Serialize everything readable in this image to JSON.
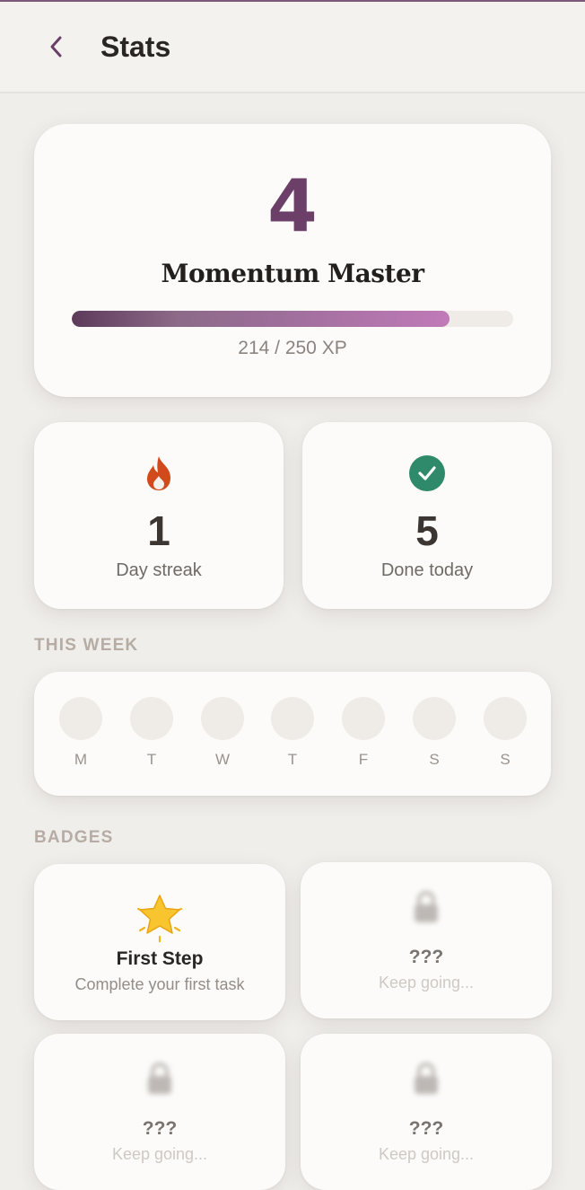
{
  "header": {
    "title": "Stats",
    "back_icon": "chevron-left-icon"
  },
  "level": {
    "number": "4",
    "name": "Momentum Master",
    "xp_current": 214,
    "xp_max": 250,
    "xp_text": "214 / 250 XP",
    "accent": "#6b3f68"
  },
  "stats": [
    {
      "icon": "flame-icon",
      "value": "1",
      "label": "Day streak",
      "color": "#d24a1c"
    },
    {
      "icon": "check-circle-icon",
      "value": "5",
      "label": "Done today",
      "color": "#2e8a6a"
    }
  ],
  "week": {
    "title": "THIS WEEK",
    "days": [
      "M",
      "T",
      "W",
      "T",
      "F",
      "S",
      "S"
    ]
  },
  "badges": {
    "title": "BADGES",
    "items": [
      {
        "icon": "star-icon",
        "title": "First Step",
        "desc": "Complete your first task",
        "locked": false
      },
      {
        "icon": "lock-icon",
        "title": "???",
        "desc": "Keep going...",
        "locked": true
      },
      {
        "icon": "lock-icon",
        "title": "???",
        "desc": "Keep going...",
        "locked": true
      },
      {
        "icon": "lock-icon",
        "title": "???",
        "desc": "Keep going...",
        "locked": true
      }
    ]
  }
}
